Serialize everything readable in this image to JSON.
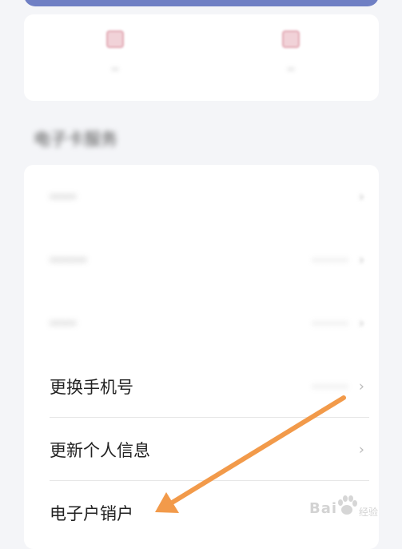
{
  "quick_actions": [
    {
      "icon": "blurred-icon",
      "label": "··"
    },
    {
      "icon": "blurred-icon",
      "label": "··"
    }
  ],
  "section_title": "电子卡服务",
  "rows": [
    {
      "label": "·····",
      "value": "",
      "blurred": true
    },
    {
      "label": "·······",
      "value": "·········",
      "blurred": true
    },
    {
      "label": "·····",
      "value": "·········",
      "blurred": true
    },
    {
      "label": "更换手机号",
      "value": "·········",
      "blurred": false
    },
    {
      "label": "更新个人信息",
      "value": "",
      "blurred": false
    },
    {
      "label": "电子户销户",
      "value": "",
      "blurred": false
    }
  ],
  "chevron": "›",
  "arrow_color": "#f29a4a",
  "watermark": {
    "text": "Bai",
    "sub": "经验"
  }
}
